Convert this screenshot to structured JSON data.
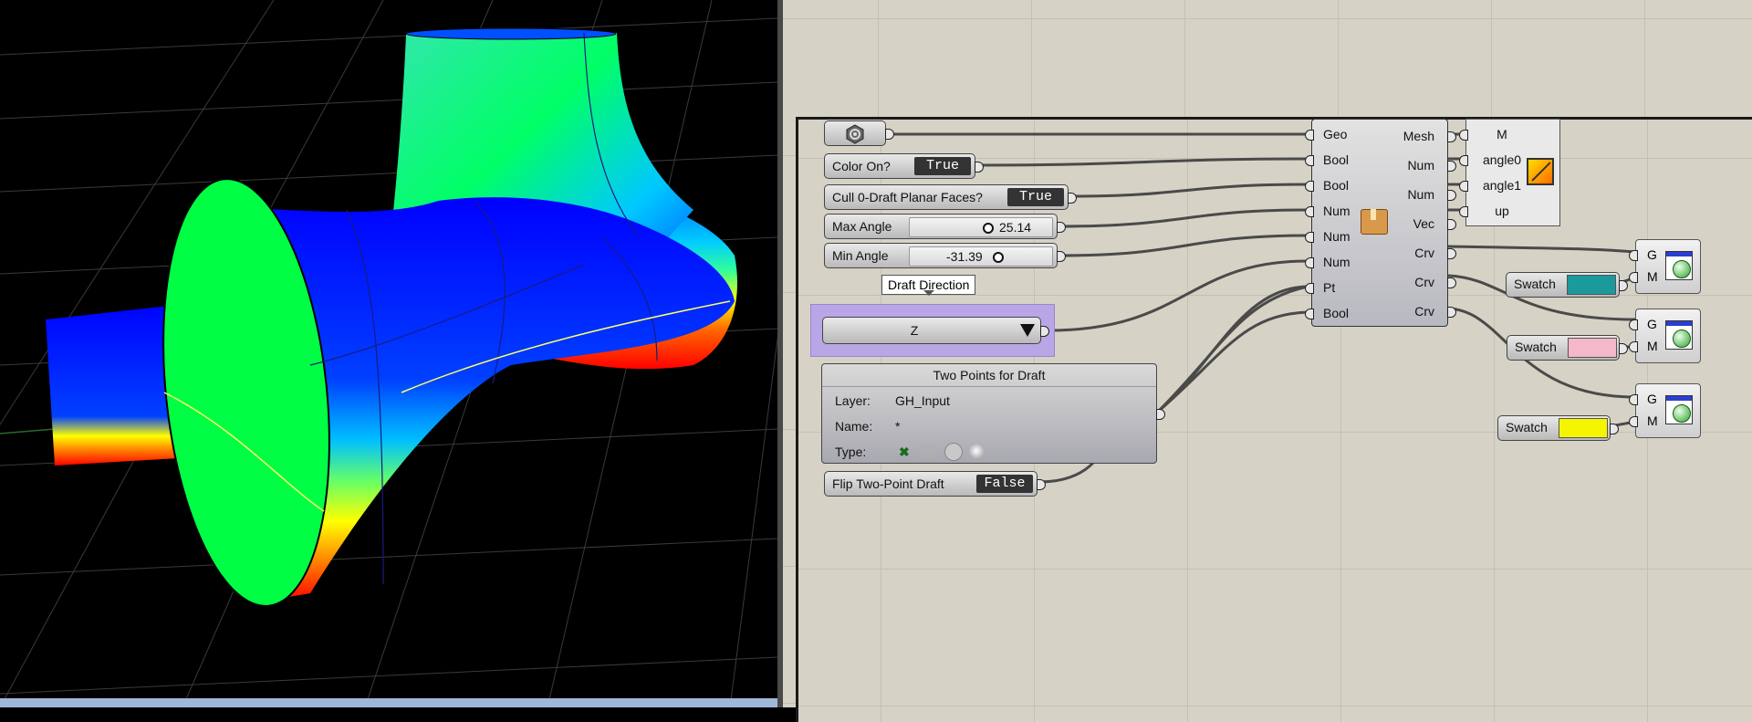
{
  "components": {
    "geometry_param": {
      "icon": "geometry-param-icon"
    },
    "color_toggle": {
      "label": "Color On?",
      "value": "True"
    },
    "cull_toggle": {
      "label": "Cull 0-Draft Planar Faces?",
      "value": "True"
    },
    "max_slider": {
      "label": "Max Angle",
      "value": "25.14",
      "level": 0.55
    },
    "min_slider": {
      "label": "Min Angle",
      "value": "-31.39",
      "level": 0.62
    },
    "draft_tooltip": "Draft Direction",
    "draft_value_list": {
      "value": "Z"
    },
    "two_points": {
      "title": "Two Points for Draft",
      "layer_label": "Layer:",
      "layer_value": "GH_Input",
      "name_label": "Name:",
      "name_value": "*",
      "type_label": "Type:"
    },
    "flip_toggle": {
      "label": "Flip Two-Point Draft",
      "value": "False"
    },
    "cluster": {
      "inputs": [
        "Geo",
        "Bool",
        "Bool",
        "Num",
        "Num",
        "Num",
        "Pt",
        "Bool"
      ],
      "outputs": [
        "Mesh",
        "Num",
        "Num",
        "Vec",
        "Crv",
        "Crv",
        "Crv"
      ],
      "icon": "package-icon"
    },
    "preview_panel": {
      "ports": [
        "M",
        "angle0",
        "angle1",
        "up"
      ],
      "icon": "gradient-icon"
    },
    "viewers": [
      {
        "ports": [
          "G",
          "M"
        ],
        "icon": "preview-icon"
      },
      {
        "ports": [
          "G",
          "M"
        ],
        "icon": "preview-icon"
      },
      {
        "ports": [
          "G",
          "M"
        ],
        "icon": "preview-icon"
      }
    ],
    "swatches": [
      {
        "label": "Swatch",
        "color": "#1a9a9a"
      },
      {
        "label": "Swatch",
        "color": "#f4b8c8"
      },
      {
        "label": "Swatch",
        "color": "#f5f500"
      }
    ]
  },
  "colors": {
    "canvas": "#d6d2c6",
    "viewport_bg": "#000000",
    "value_list_highlight": "#b9a6e6",
    "wire": "#4a4a4a"
  }
}
